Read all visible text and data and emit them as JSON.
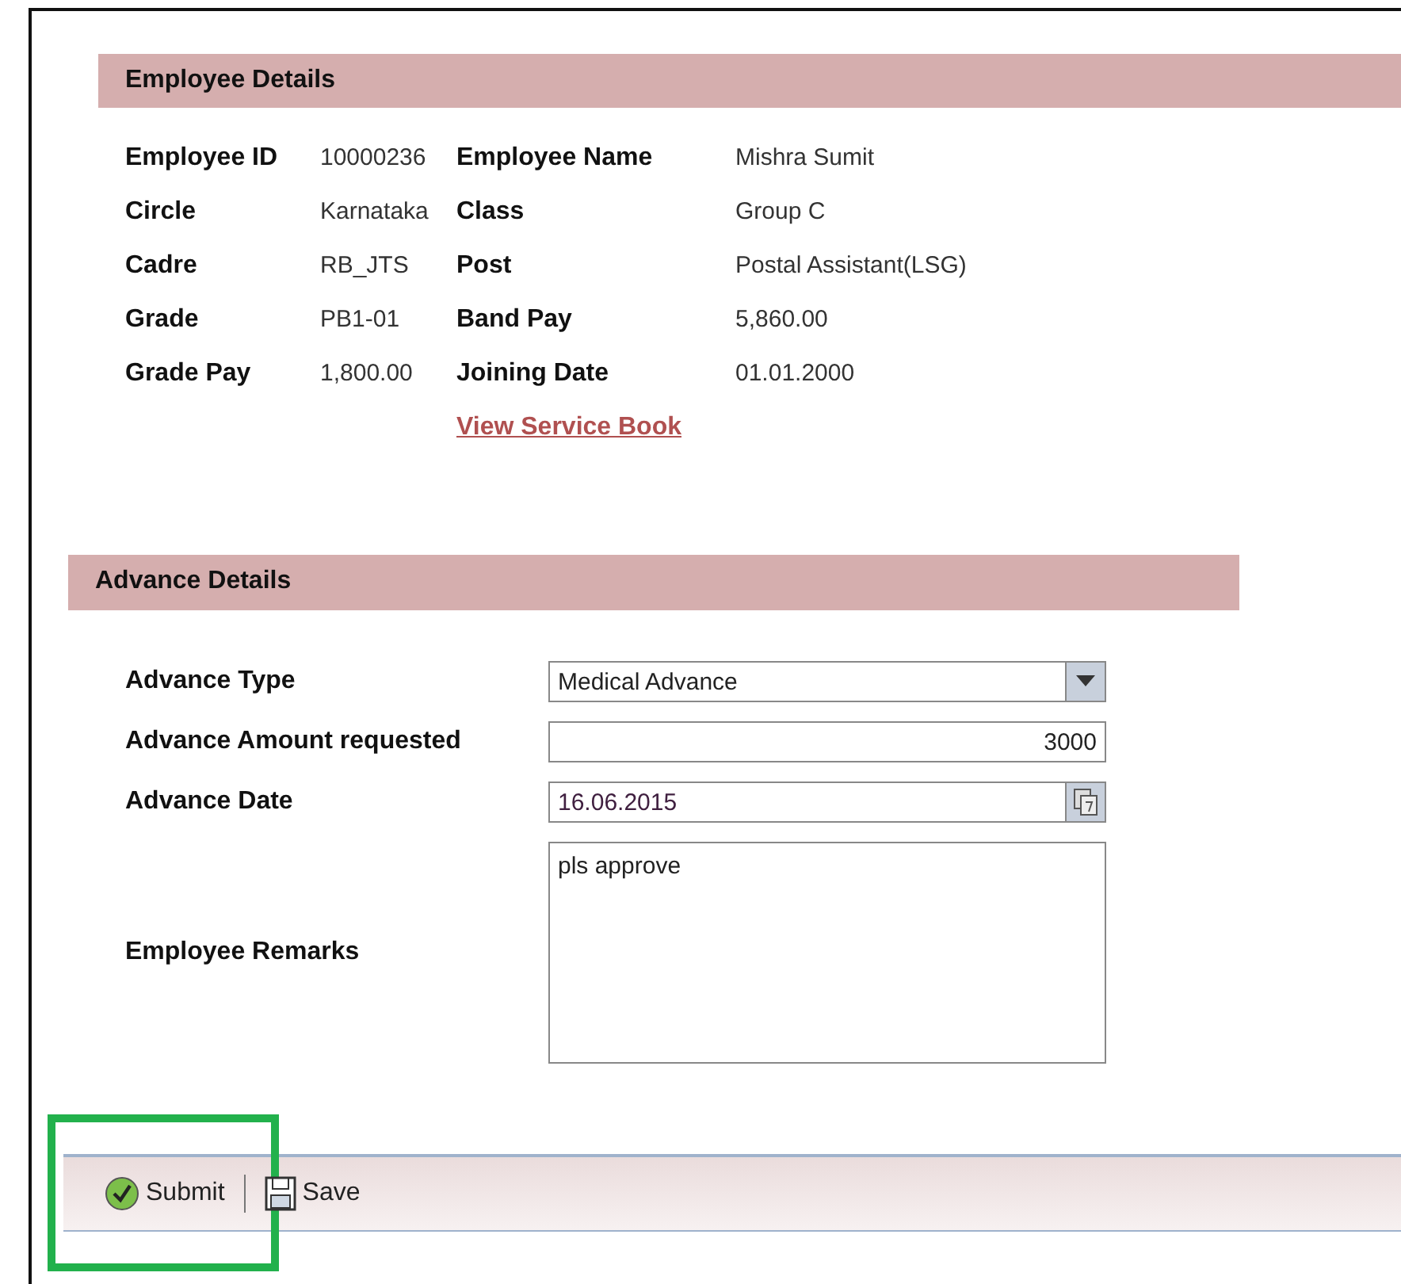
{
  "employee_details": {
    "title": "Employee Details",
    "rows": [
      {
        "label": "Employee ID",
        "value": "10000236",
        "label_2": "Employee Name",
        "value_2": "Mishra Sumit"
      },
      {
        "label": "Circle",
        "value": "Karnataka",
        "label_2": "Class",
        "value_2": "Group C"
      },
      {
        "label": "Cadre",
        "value": "RB_JTS",
        "label_2": "Post",
        "value_2": "Postal Assistant(LSG)"
      },
      {
        "label": "Grade",
        "value": "PB1-01",
        "label_2": "Band Pay",
        "value_2": "5,860.00"
      },
      {
        "label": "Grade Pay",
        "value": "1,800.00",
        "label_2": "Joining Date",
        "value_2": "01.01.2000"
      }
    ],
    "link": "View Service Book"
  },
  "advance_details": {
    "title": "Advance Details",
    "fields": [
      {
        "kind": "dropdown",
        "label": "Advance Type",
        "value": "Medical Advance"
      },
      {
        "kind": "number",
        "label": "Advance Amount requested",
        "value": "3000"
      },
      {
        "kind": "date",
        "label": "Advance Date",
        "value": "16.06.2015"
      },
      {
        "kind": "textarea",
        "label": "Employee Remarks",
        "value": "pls approve"
      }
    ]
  },
  "toolbar": {
    "buttons": [
      {
        "kind": "submit",
        "label": "Submit",
        "highlighted": true
      },
      {
        "kind": "save",
        "label": "Save",
        "highlighted": false
      }
    ]
  }
}
